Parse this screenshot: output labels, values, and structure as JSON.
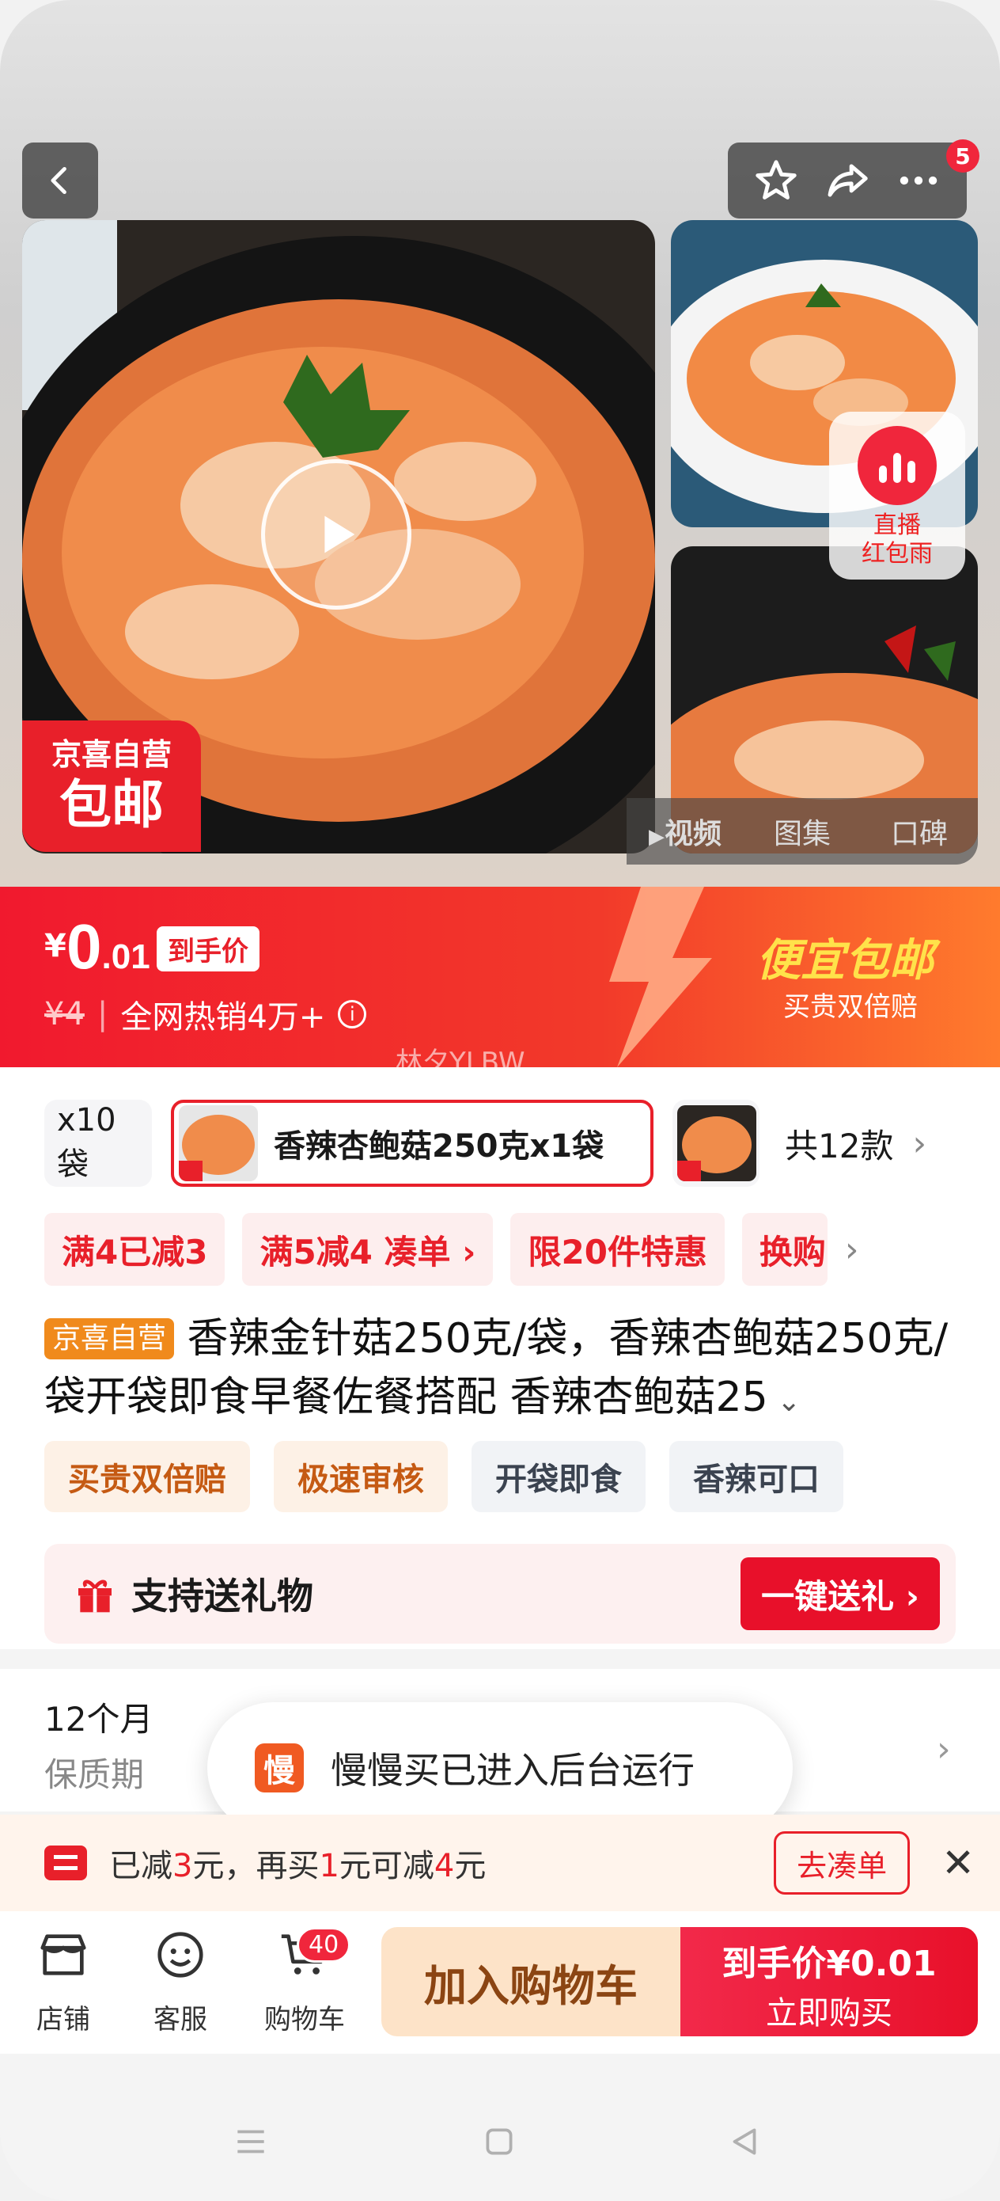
{
  "header": {
    "cart_count_badge": "5"
  },
  "gallery": {
    "shop_badge_line1": "京喜自营",
    "shop_badge_line2": "包邮",
    "live_line1": "直播",
    "live_line2": "红包雨",
    "tabs": [
      {
        "label": "视频",
        "active": true
      },
      {
        "label": "图集",
        "active": false
      },
      {
        "label": "口碑",
        "active": false
      }
    ]
  },
  "price": {
    "currency": "¥",
    "amount": "0",
    "amount_decimal": ".01",
    "tag": "到手价",
    "original": "¥4",
    "sales": "全网热销4万+",
    "promo_title": "便宜包邮",
    "promo_sub": "买贵双倍赔",
    "watermark": "林夕YLBW"
  },
  "variants": {
    "items": [
      {
        "label": "x10袋",
        "selected": false
      },
      {
        "label": "香辣杏鲍菇250克x1袋",
        "selected": true
      },
      {
        "label": "",
        "selected": false
      }
    ],
    "total": "共12款"
  },
  "coupons": [
    "满4已减3",
    "满5减4 凑单 ›",
    "限20件特惠",
    "换购"
  ],
  "product": {
    "store_tag": "京喜自营",
    "title": "香辣金针菇250克/袋，香辣杏鲍菇250克/袋开袋即食早餐佐餐搭配 香辣杏鲍菇25"
  },
  "tags": [
    "买贵双倍赔",
    "极速审核",
    "开袋即食",
    "香辣可口"
  ],
  "gift": {
    "label": "支持送礼物",
    "button": "一键送礼 ›"
  },
  "spec": {
    "value": "12个月",
    "key": "保质期"
  },
  "toast": {
    "icon_text": "慢",
    "text": "慢慢买已进入后台运行"
  },
  "promo": {
    "p1": "已减",
    "n1": "3",
    "p2": "元，再买",
    "n2": "1",
    "p3": "元可减",
    "n3": "4",
    "p4": "元",
    "button": "去凑单"
  },
  "bottom": {
    "shop": "店铺",
    "service": "客服",
    "cart": "购物车",
    "cart_count": "40",
    "add_to_cart": "加入购物车",
    "buy_line1": "到手价¥0.01",
    "buy_line2": "立即购买"
  },
  "colors": {
    "brand_red": "#e8202a",
    "orange": "#f08a1c"
  }
}
